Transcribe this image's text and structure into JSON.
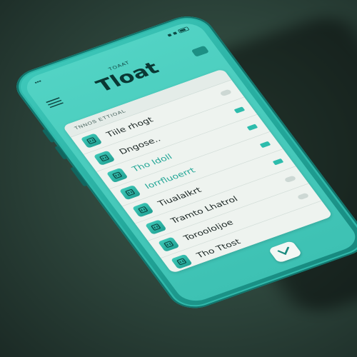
{
  "status_bar": {
    "time": "▪▪▪"
  },
  "header": {
    "small_label": "TOAAT",
    "title": "Tloat"
  },
  "list": {
    "section_label": "TNNOS ETTIOAL",
    "items": [
      {
        "label": "Tiile rhogt",
        "highlight": false,
        "marker": "toggle"
      },
      {
        "label": "Dngose..",
        "highlight": false,
        "marker": "badge"
      },
      {
        "label": "Tho Idoll",
        "highlight": true,
        "marker": "badge"
      },
      {
        "label": "Iorrfluoerrt",
        "highlight": true,
        "marker": "badge"
      },
      {
        "label": "Tiualalkrt",
        "highlight": false,
        "marker": "badge"
      },
      {
        "label": "Tramto Lhatrol",
        "highlight": false,
        "marker": "toggle"
      },
      {
        "label": "Toroololjoe",
        "highlight": false,
        "marker": "toggle"
      },
      {
        "label": "Tho Ttost",
        "highlight": false,
        "marker": "none"
      }
    ]
  },
  "colors": {
    "accent": "#2dbcac",
    "phone_body": "#23a89b",
    "screen": "#4bcbbd",
    "list_bg": "#eef3ef"
  }
}
